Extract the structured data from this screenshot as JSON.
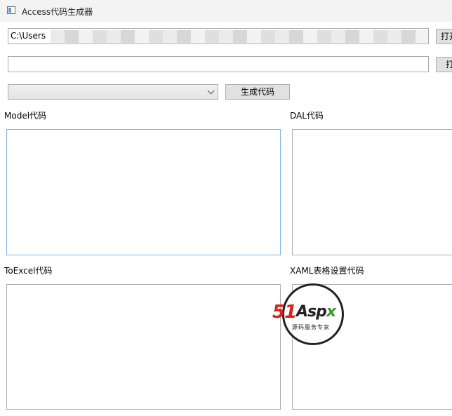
{
  "window": {
    "title": "Access代码生成器"
  },
  "row1": {
    "path_value": "C:\\Users",
    "button_label": "打开"
  },
  "row2": {
    "path_value": "",
    "button_label": "打开"
  },
  "generate": {
    "table_select_value": "",
    "button_label": "生成代码"
  },
  "sections": {
    "model": {
      "label": "Model代码",
      "content": ""
    },
    "dal": {
      "label": "DAL代码",
      "content": ""
    },
    "toexcel": {
      "label": "ToExcel代码",
      "content": ""
    },
    "xaml": {
      "label": "XAML表格设置代码",
      "content": ""
    }
  },
  "watermark": {
    "brand_number": "51",
    "brand_word": "Asp",
    "brand_letter": "x",
    "tagline": "源码服务专家"
  },
  "colors": {
    "focus_border": "#7eb4ea",
    "brand_red": "#d6231c",
    "brand_green": "#3a9b2c"
  }
}
